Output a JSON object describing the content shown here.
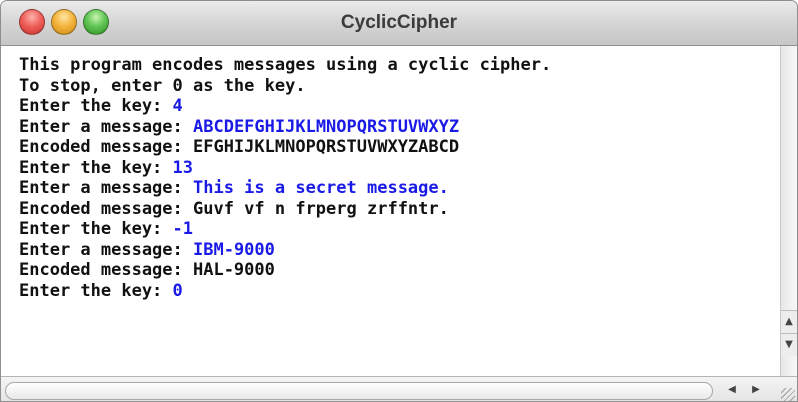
{
  "window": {
    "title": "CyclicCipher"
  },
  "console": {
    "lines": [
      {
        "prompt": "This program encodes messages using a cyclic cipher.",
        "input": ""
      },
      {
        "prompt": "To stop, enter 0 as the key.",
        "input": ""
      },
      {
        "prompt": "Enter the key: ",
        "input": "4"
      },
      {
        "prompt": "Enter a message: ",
        "input": "ABCDEFGHIJKLMNOPQRSTUVWXYZ"
      },
      {
        "prompt": "Encoded message: EFGHIJKLMNOPQRSTUVWXYZABCD",
        "input": ""
      },
      {
        "prompt": "Enter the key: ",
        "input": "13"
      },
      {
        "prompt": "Enter a message: ",
        "input": "This is a secret message."
      },
      {
        "prompt": "Encoded message: Guvf vf n frperg zrffntr.",
        "input": ""
      },
      {
        "prompt": "Enter the key: ",
        "input": "-1"
      },
      {
        "prompt": "Enter a message: ",
        "input": "IBM-9000"
      },
      {
        "prompt": "Encoded message: HAL-9000",
        "input": ""
      },
      {
        "prompt": "Enter the key: ",
        "input": "0"
      }
    ]
  },
  "colors": {
    "prompt_text": "#111111",
    "user_input": "#1a1ae6"
  },
  "icons": {
    "close": "close-icon",
    "minimize": "minimize-icon",
    "zoom": "zoom-icon",
    "scroll_up": "up-arrow-icon",
    "scroll_down": "down-arrow-icon",
    "scroll_left": "left-arrow-icon",
    "scroll_right": "right-arrow-icon",
    "resize": "resize-grip-icon"
  }
}
